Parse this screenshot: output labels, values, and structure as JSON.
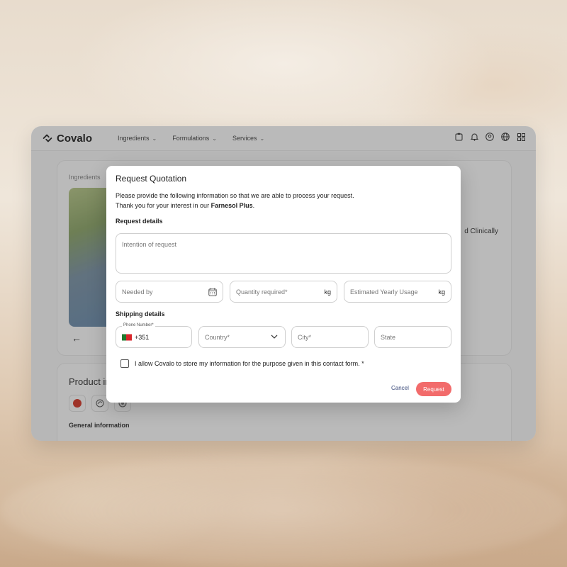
{
  "app": {
    "logo_text": "Covalo",
    "nav": [
      {
        "label": "Ingredients"
      },
      {
        "label": "Formulations"
      },
      {
        "label": "Services"
      }
    ],
    "top_icons": [
      "clipboard-icon",
      "bell-icon",
      "user-icon",
      "globe-icon",
      "grid-icon"
    ]
  },
  "background_page": {
    "breadcrumb": "Ingredients",
    "side_text": "d Clinically",
    "product_title": "Product in",
    "general_info": "General information"
  },
  "modal": {
    "title": "Request Quotation",
    "desc_line1": "Please provide the following information so that we are able to process your request.",
    "desc_line2_prefix": "Thank you for your interest in our ",
    "product_name": "Farnesol Plus",
    "desc_line2_suffix": ".",
    "request_details_heading": "Request details",
    "intention_placeholder": "Intention of request",
    "needed_by_placeholder": "Needed by",
    "quantity_placeholder": "Quantity required*",
    "quantity_unit": "kg",
    "yearly_placeholder": "Estimated Yearly Usage",
    "yearly_unit": "kg",
    "shipping_heading": "Shipping details",
    "phone_label": "Phone Number*",
    "phone_code": "+351",
    "country_placeholder": "Country*",
    "city_placeholder": "City*",
    "state_placeholder": "State",
    "consent_text": "I allow Covalo to store my information for the purpose given in this contact form. *",
    "cancel_label": "Cancel",
    "request_label": "Request"
  },
  "colors": {
    "accent": "#f26b6b",
    "cancel_text": "#3a4a7a",
    "flag_green": "#1f7a2e",
    "flag_red": "#d8262b"
  }
}
